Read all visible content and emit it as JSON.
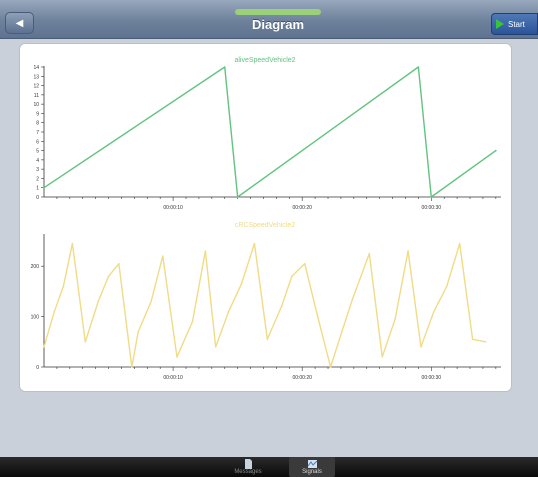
{
  "navbar": {
    "title": "Diagram",
    "back_icon": "back-arrow-icon",
    "start_label": "Start",
    "start_icon": "play-icon"
  },
  "tabbar": {
    "tabs": [
      {
        "label": "Messages",
        "icon": "document-icon",
        "active": false
      },
      {
        "label": "Signals",
        "icon": "chart-icon",
        "active": true
      }
    ]
  },
  "chart_data": [
    {
      "type": "line",
      "title": "aliveSpeedVehicle2",
      "color": "#62c47e",
      "x": [
        "00:00:00",
        "00:00:14",
        "00:00:15",
        "00:00:29",
        "00:00:30",
        "00:00:35"
      ],
      "values": [
        1,
        14,
        0,
        14,
        0,
        5
      ],
      "ylim": [
        0,
        14
      ],
      "yticks": [
        0,
        1,
        2,
        3,
        4,
        5,
        6,
        7,
        8,
        9,
        10,
        11,
        12,
        13,
        14
      ],
      "xticks": [
        "00:00:10",
        "00:00:20",
        "00:00:30"
      ],
      "grid": false
    },
    {
      "type": "line",
      "title": "cRCSpeedVehicle2",
      "color": "#f0db86",
      "x": [
        0,
        0.8,
        1.5,
        2.2,
        3.2,
        4.2,
        5,
        5.8,
        6.8,
        7.3,
        8.3,
        9.2,
        10.3,
        11.5,
        12.5,
        13.3,
        14.3,
        15.3,
        16.3,
        17.3,
        18.4,
        19.2,
        20.2,
        21.2,
        22.2,
        23.2,
        23.9,
        25.2,
        26.2,
        27.2,
        28.2,
        29.2,
        30.2,
        31.2,
        32.2,
        33.2,
        34.2
      ],
      "values": [
        40,
        110,
        160,
        245,
        50,
        130,
        180,
        205,
        0,
        70,
        130,
        220,
        20,
        90,
        230,
        40,
        110,
        165,
        245,
        55,
        120,
        180,
        205,
        100,
        0,
        80,
        135,
        225,
        20,
        95,
        230,
        40,
        110,
        160,
        245,
        55,
        50
      ],
      "ylim": [
        0,
        250
      ],
      "yticks": [
        0,
        100,
        200
      ],
      "xticks": [
        "00:00:10",
        "00:00:20",
        "00:00:30"
      ],
      "grid": false
    }
  ]
}
